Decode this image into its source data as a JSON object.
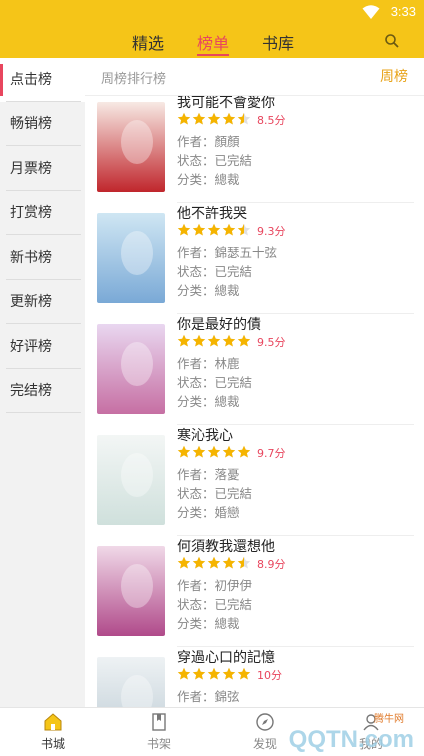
{
  "status_bar": {
    "time": "3:33",
    "wifi_icon": "wifi-icon"
  },
  "top_tabs": [
    {
      "label": "精选",
      "active": false
    },
    {
      "label": "榜单",
      "active": true
    },
    {
      "label": "书库",
      "active": false
    }
  ],
  "search_icon": "search-icon",
  "colors": {
    "brand": "#f5c518",
    "accent": "#e8465e",
    "star": "#f5b400",
    "period": "#e8a318"
  },
  "sidebar": {
    "items": [
      {
        "label": "点击榜",
        "active": true
      },
      {
        "label": "畅销榜",
        "active": false
      },
      {
        "label": "月票榜",
        "active": false
      },
      {
        "label": "打赏榜",
        "active": false
      },
      {
        "label": "新书榜",
        "active": false
      },
      {
        "label": "更新榜",
        "active": false
      },
      {
        "label": "好评榜",
        "active": false
      },
      {
        "label": "完结榜",
        "active": false
      }
    ]
  },
  "subheader": {
    "label": "周榜排行榜",
    "period": "周榜"
  },
  "books": [
    {
      "title": "我可能不會愛你",
      "rating": 4.5,
      "score": "8.5分",
      "author": "作者：顏顏",
      "status": "状态：已完結",
      "category": "分类：總裁",
      "cover_colors": [
        "#f7e9e4",
        "#c0262c"
      ]
    },
    {
      "title": "他不許我哭",
      "rating": 4.5,
      "score": "9.3分",
      "author": "作者：錦瑟五十弦",
      "status": "状态：已完結",
      "category": "分类：總裁",
      "cover_colors": [
        "#cfe6f3",
        "#7aa9d6"
      ]
    },
    {
      "title": "你是最好的債",
      "rating": 5,
      "score": "9.5分",
      "author": "作者：林鹿",
      "status": "状态：已完結",
      "category": "分类：總裁",
      "cover_colors": [
        "#e9d7f0",
        "#c66fa3"
      ]
    },
    {
      "title": "寒沁我心",
      "rating": 5,
      "score": "9.7分",
      "author": "作者：落憂",
      "status": "状态：已完結",
      "category": "分类：婚戀",
      "cover_colors": [
        "#f3f6f5",
        "#cfe0dc"
      ]
    },
    {
      "title": "何須教我還想他",
      "rating": 4.5,
      "score": "8.9分",
      "author": "作者：初伊伊",
      "status": "状态：已完結",
      "category": "分类：總裁",
      "cover_colors": [
        "#f0d9e8",
        "#b04a8a"
      ]
    },
    {
      "title": "穿過心口的記憶",
      "rating": 5,
      "score": "10分",
      "author": "作者：錦弦",
      "status": "状态：已完結",
      "category": "分类：總裁",
      "cover_colors": [
        "#eef2f4",
        "#bccbd4"
      ]
    }
  ],
  "bottom_nav": [
    {
      "label": "书城",
      "icon": "home-icon",
      "active": true
    },
    {
      "label": "书架",
      "icon": "bookshelf-icon",
      "active": false
    },
    {
      "label": "发现",
      "icon": "discover-icon",
      "active": false
    },
    {
      "label": "我的",
      "icon": "profile-icon",
      "active": false
    }
  ],
  "watermark": {
    "text": "QQTN.com",
    "small": "腾牛网"
  }
}
